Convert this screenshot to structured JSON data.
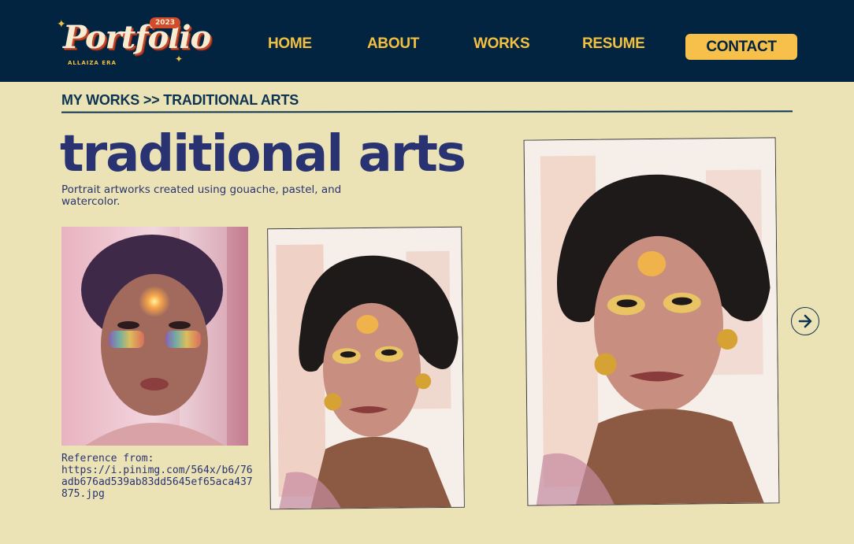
{
  "logo": {
    "word": "Portfolio",
    "year": "2023",
    "subtitle": "ALLAIZA ERA"
  },
  "nav": {
    "home": "HOME",
    "about": "ABOUT",
    "works": "WORKS",
    "resume": "RESUME",
    "contact": "CONTACT"
  },
  "breadcrumb": "MY WORKS >> TRADITIONAL ARTS",
  "page": {
    "title": "traditional arts",
    "description": "Portrait artworks created using gouache, pastel, and watercolor."
  },
  "reference": {
    "label": "Reference from:",
    "url": "https://i.pinimg.com/564x/b6/76adb676ad539ab83dd5645ef65aca437875.jpg"
  },
  "icons": {
    "next": "arrow-right-circle-icon"
  },
  "colors": {
    "header_bg": "#032441",
    "page_bg": "#ebe3b5",
    "nav_text": "#f2c040",
    "contact_bg": "#f7c04a",
    "title": "#2a3372",
    "breadcrumb": "#0d3353"
  }
}
